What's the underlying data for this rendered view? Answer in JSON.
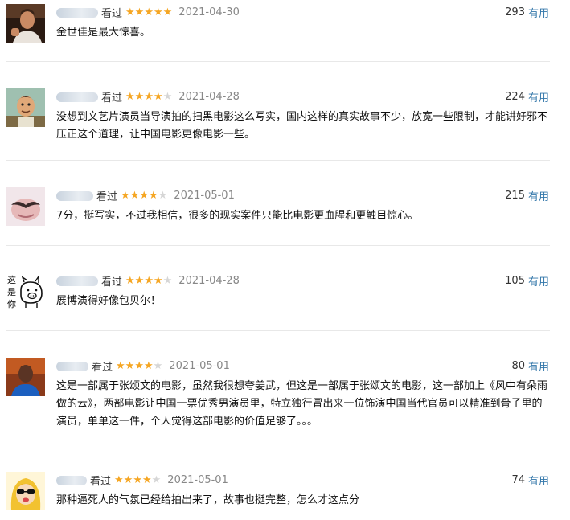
{
  "reviews": [
    {
      "seen_label": "看过",
      "stars": 5,
      "date": "2021-04-30",
      "votes": "293",
      "useful_label": "有用",
      "content": "金世佳是最大惊喜。",
      "avatar_icon": "man-portrait-icon"
    },
    {
      "seen_label": "看过",
      "stars": 4,
      "date": "2021-04-28",
      "votes": "224",
      "useful_label": "有用",
      "content": "没想到文艺片演员当导演拍的扫黑电影这么写实，国内这样的真实故事不少，放宽一些限制，才能讲好邪不压正这个道理，让中国电影更像电影一些。",
      "avatar_icon": "cartoon-man-icon"
    },
    {
      "seen_label": "看过",
      "stars": 4,
      "date": "2021-05-01",
      "votes": "215",
      "useful_label": "有用",
      "content": "7分，挺写实，不过我相信，很多的现实案件只能比电影更血腥和更触目惊心。",
      "avatar_icon": "mustache-icon"
    },
    {
      "seen_label": "看过",
      "stars": 4,
      "date": "2021-04-28",
      "votes": "105",
      "useful_label": "有用",
      "content": "展博演得好像包贝尔！",
      "avatar_icon": "pig-doodle-icon",
      "avatar_text": [
        "这",
        "是",
        "你"
      ]
    },
    {
      "seen_label": "看过",
      "stars": 4,
      "date": "2021-05-01",
      "votes": "80",
      "useful_label": "有用",
      "content": "这是一部属于张颂文的电影，虽然我很想夸姜武，但这是一部属于张颂文的电影，这一部加上《风中有朵雨做的云》，两部电影让中国一票优秀男演员里，特立独行冒出来一位饰演中国当代官员可以精准到骨子里的演员，单单这一件，个人觉得这部电影的价值足够了。。。",
      "avatar_icon": "man-blue-shirt-icon"
    },
    {
      "seen_label": "看过",
      "stars": 4,
      "date": "2021-05-01",
      "votes": "74",
      "useful_label": "有用",
      "content": "那种逼死人的气氛已经给拍出来了，故事也挺完整，怎么才这点分",
      "avatar_icon": "cartoon-girl-sunglasses-icon"
    }
  ]
}
